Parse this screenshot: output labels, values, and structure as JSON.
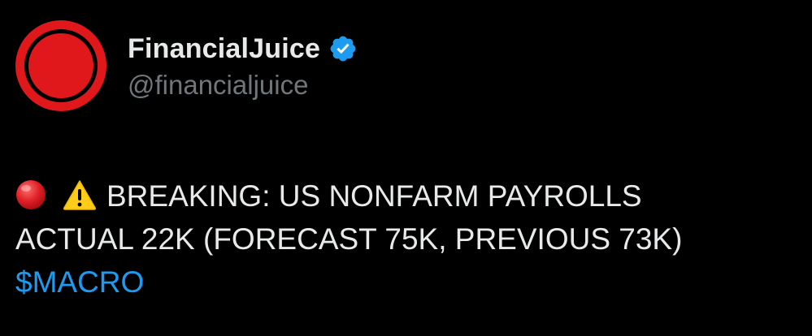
{
  "tweet": {
    "author": {
      "display_name": "FinancialJuice",
      "handle": "@financialjuice",
      "verified": true,
      "avatar_icon": "red-circle-logo"
    },
    "body": {
      "emojis": [
        "red-circle-emoji",
        "warning-emoji"
      ],
      "line1": "BREAKING: US NONFARM PAYROLLS",
      "line2": "ACTUAL 22K (FORECAST 75K, PREVIOUS 73K)",
      "cashtag": "$MACRO"
    }
  },
  "colors": {
    "background": "#000000",
    "text_primary": "#e7e9ea",
    "text_secondary": "#71767b",
    "link": "#1d9bf0",
    "verified_badge": "#1d9bf0",
    "brand_red": "#e0181b"
  }
}
